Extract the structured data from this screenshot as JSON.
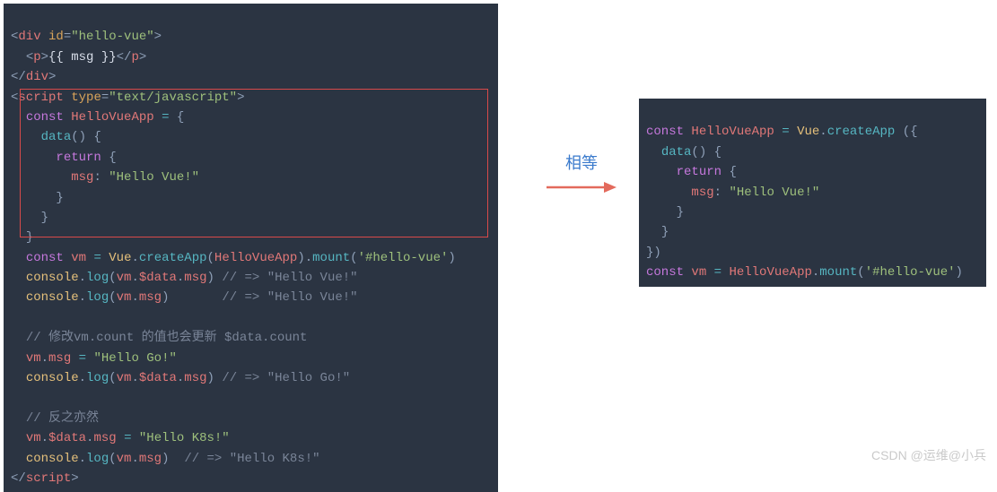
{
  "left_code": {
    "l1": "<div id=\"hello-vue\">",
    "l2": "  <p>{{ msg }}</p>",
    "l3": "</div>",
    "l4": "<script type=\"text/javascript\">",
    "l5": "  const HelloVueApp = {",
    "l6": "    data() {",
    "l7": "      return {",
    "l8": "        msg: \"Hello Vue!\"",
    "l9": "      }",
    "l10": "    }",
    "l11": "  }",
    "l12": "  const vm = Vue.createApp(HelloVueApp).mount('#hello-vue')",
    "l13": "  console.log(vm.$data.msg) // => \"Hello Vue!\"",
    "l14": "  console.log(vm.msg)       // => \"Hello Vue!\"",
    "l15": "",
    "l16": "  // 修改vm.count 的值也会更新 $data.count",
    "l17": "  vm.msg = \"Hello Go!\"",
    "l18": "  console.log(vm.$data.msg) // => \"Hello Go!\"",
    "l19": "",
    "l20": "  // 反之亦然",
    "l21": "  vm.$data.msg = \"Hello K8s!\"",
    "l22": "  console.log(vm.msg)  // => \"Hello K8s!\"",
    "l23": "</script>"
  },
  "right_code": {
    "l1": "const HelloVueApp = Vue.createApp ({",
    "l2": "  data() {",
    "l3": "    return {",
    "l4": "      msg: \"Hello Vue!\"",
    "l5": "    }",
    "l6": "  }",
    "l7": "})",
    "l8": "const vm = HelloVueApp.mount('#hello-vue')"
  },
  "arrow_label": "相等",
  "watermark": "CSDN @运维@小兵"
}
